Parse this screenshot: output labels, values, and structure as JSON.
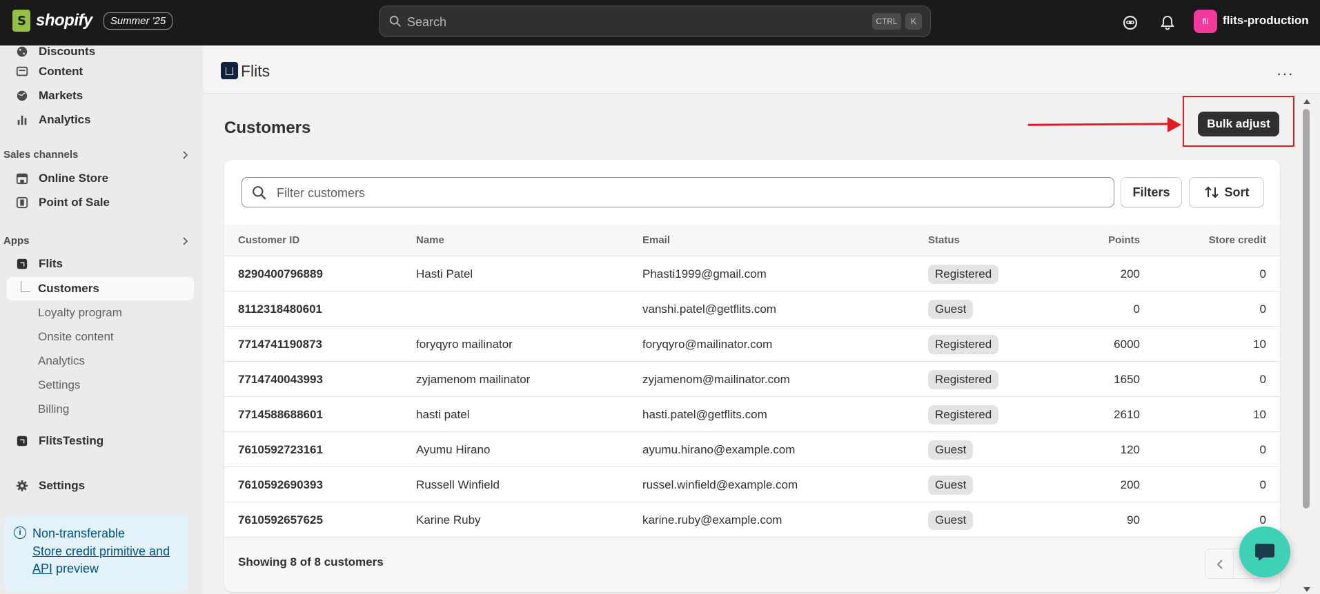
{
  "topbar": {
    "brand": "shopify",
    "edition": "Summer '25",
    "search_placeholder": "Search",
    "shortcut_ctrl": "CTRL",
    "shortcut_k": "K",
    "store_initials": "fli",
    "store_name": "flits-production"
  },
  "sidebar": {
    "items_top": [
      {
        "label": "Discounts",
        "icon": "discount-icon"
      },
      {
        "label": "Content",
        "icon": "content-icon"
      },
      {
        "label": "Markets",
        "icon": "globe-icon"
      },
      {
        "label": "Analytics",
        "icon": "bar-chart-icon"
      }
    ],
    "sales_channels_heading": "Sales channels",
    "sales_channels": [
      {
        "label": "Online Store",
        "icon": "store-icon"
      },
      {
        "label": "Point of Sale",
        "icon": "pos-icon"
      }
    ],
    "apps_heading": "Apps",
    "app_name": "Flits",
    "app_subitems": [
      "Customers",
      "Loyalty program",
      "Onsite content",
      "Analytics",
      "Settings",
      "Billing"
    ],
    "other_app": "FlitsTesting",
    "settings": "Settings",
    "promo": {
      "title": "Non-transferable",
      "link": "Store credit primitive and API",
      "suffix": "preview"
    }
  },
  "app_header": {
    "name": "Flits",
    "more": "···"
  },
  "page": {
    "title": "Customers",
    "bulk_adjust": "Bulk adjust",
    "filter_placeholder": "Filter customers",
    "filters_label": "Filters",
    "sort_label": "Sort"
  },
  "table": {
    "headers": {
      "id": "Customer ID",
      "name": "Name",
      "email": "Email",
      "status": "Status",
      "points": "Points",
      "credit": "Store credit"
    },
    "rows": [
      {
        "id": "8290400796889",
        "name": "Hasti Patel",
        "email": "Phasti1999@gmail.com",
        "status": "Registered",
        "points": "200",
        "credit": "0"
      },
      {
        "id": "8112318480601",
        "name": "",
        "email": "vanshi.patel@getflits.com",
        "status": "Guest",
        "points": "0",
        "credit": "0"
      },
      {
        "id": "7714741190873",
        "name": "foryqyro mailinator",
        "email": "foryqyro@mailinator.com",
        "status": "Registered",
        "points": "6000",
        "credit": "10"
      },
      {
        "id": "7714740043993",
        "name": "zyjamenom mailinator",
        "email": "zyjamenom@mailinator.com",
        "status": "Registered",
        "points": "1650",
        "credit": "0"
      },
      {
        "id": "7714588688601",
        "name": "hasti patel",
        "email": "hasti.patel@getflits.com",
        "status": "Registered",
        "points": "2610",
        "credit": "10"
      },
      {
        "id": "7610592723161",
        "name": "Ayumu Hirano",
        "email": "ayumu.hirano@example.com",
        "status": "Guest",
        "points": "120",
        "credit": "0"
      },
      {
        "id": "7610592690393",
        "name": "Russell Winfield",
        "email": "russel.winfield@example.com",
        "status": "Guest",
        "points": "200",
        "credit": "0"
      },
      {
        "id": "7610592657625",
        "name": "Karine Ruby",
        "email": "karine.ruby@example.com",
        "status": "Guest",
        "points": "90",
        "credit": "0"
      }
    ],
    "footer": "Showing 8 of 8 customers"
  },
  "colors": {
    "topbar": "#1a1a1a",
    "annotation": "#e01b24",
    "chat_button": "#3fd0b8",
    "store_badge": "#f2399e"
  }
}
